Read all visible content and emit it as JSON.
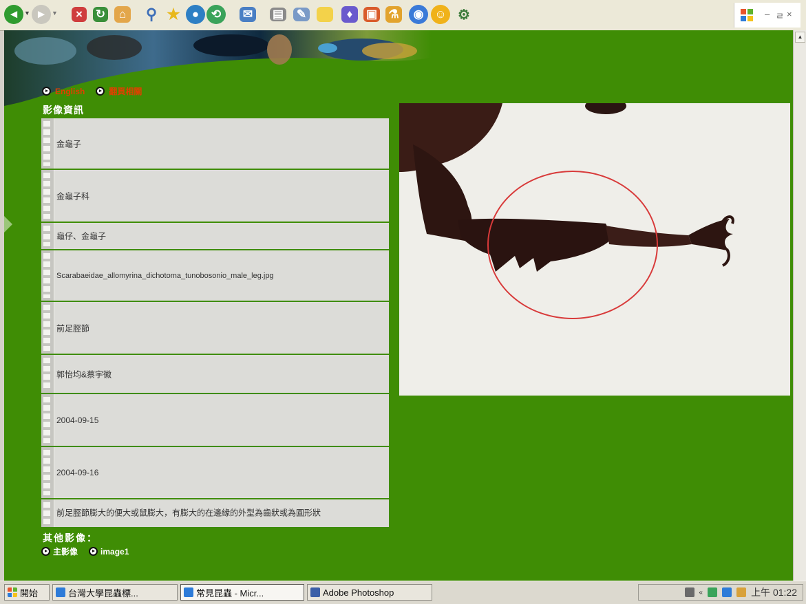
{
  "toolbar": {
    "icons": [
      "back-icon",
      "forward-icon",
      "stop-icon",
      "refresh-icon",
      "home-icon",
      "search-icon",
      "favorites-icon",
      "media-icon",
      "history-icon",
      "mail-icon",
      "print-icon",
      "edit-icon",
      "discuss-icon",
      "messenger-icon",
      "research-icon",
      "toolbox-icon",
      "settings-icon",
      "smiley-icon",
      "tools-icon"
    ],
    "window_controls": {
      "minimize": "–",
      "restore": "ㄹ",
      "close": "×"
    }
  },
  "nav": {
    "english_label": "English",
    "other_label": "翻頁相關"
  },
  "info": {
    "title": "影像資訊",
    "rows": [
      {
        "value": "金龜子"
      },
      {
        "value": "金龜子科"
      },
      {
        "value": "龜仔、金龜子"
      },
      {
        "value": "Scarabaeidae_allomyrina_dichotoma_tunobosonio_male_leg.jpg"
      },
      {
        "value": "前足脛節"
      },
      {
        "value": "郭怡均&蔡宇徽"
      },
      {
        "value": "2004-09-15"
      },
      {
        "value": "2004-09-16"
      },
      {
        "value": "前足脛節膨大的便大或鼠膨大，有膨大的在邊緣的外型為齒狀或為圓形狀"
      }
    ]
  },
  "others": {
    "title": "其他影像：",
    "links": [
      "主影像",
      "image1"
    ]
  },
  "taskbar": {
    "start_label": "開始",
    "tasks": [
      {
        "label": "台灣大學昆蟲標...",
        "active": false
      },
      {
        "label": "常見昆蟲 - Micr...",
        "active": true
      },
      {
        "label": "Adobe Photoshop",
        "active": false
      }
    ],
    "clock": "上午 01:22"
  },
  "colors": {
    "page_bg": "#3f8d05",
    "link_orange": "#e04000",
    "table_bg": "#dcdcd8"
  }
}
